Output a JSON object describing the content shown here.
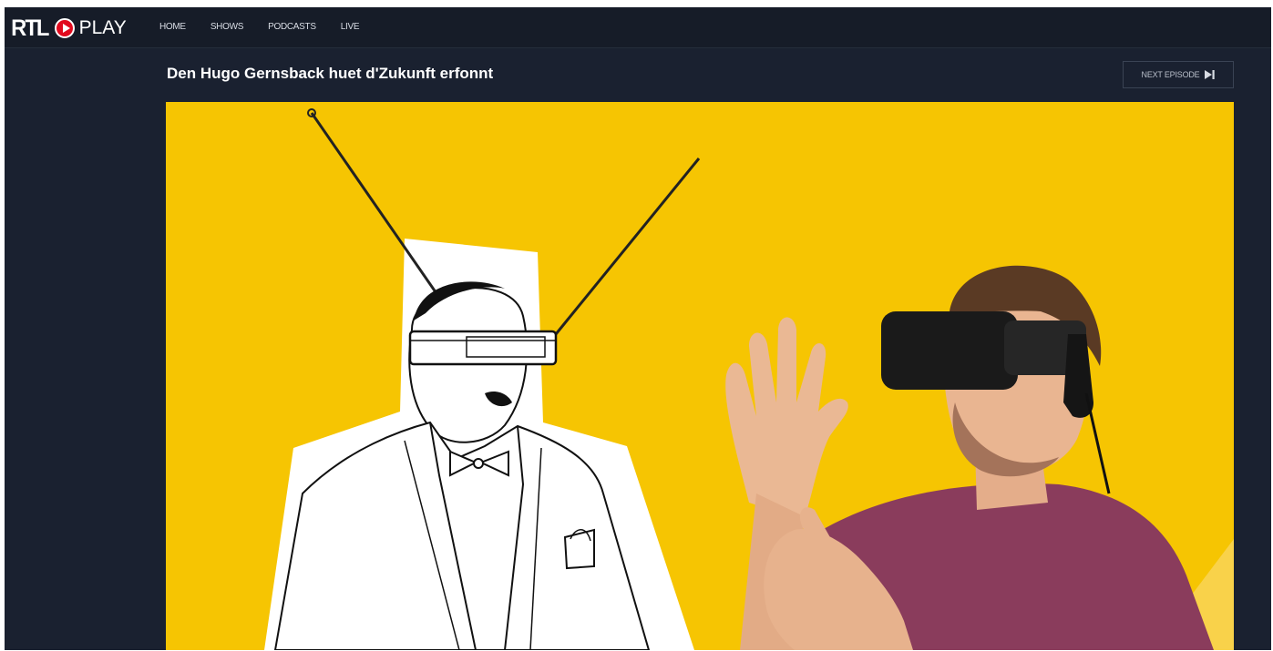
{
  "brand": {
    "rtl": "RTL",
    "play": "PLAY",
    "accent": "#e10a1e"
  },
  "nav": {
    "items": [
      "HOME",
      "SHOWS",
      "PODCASTS",
      "LIVE"
    ]
  },
  "episode": {
    "title": "Den Hugo Gernsback huet d'Zukunft erfonnt"
  },
  "next_episode": {
    "label": "NEXT EPISODE",
    "icon": "skip-next-icon"
  },
  "video": {
    "background": "#f6c502"
  },
  "colors": {
    "header_bg": "#161c28",
    "page_bg": "#1a2130"
  }
}
